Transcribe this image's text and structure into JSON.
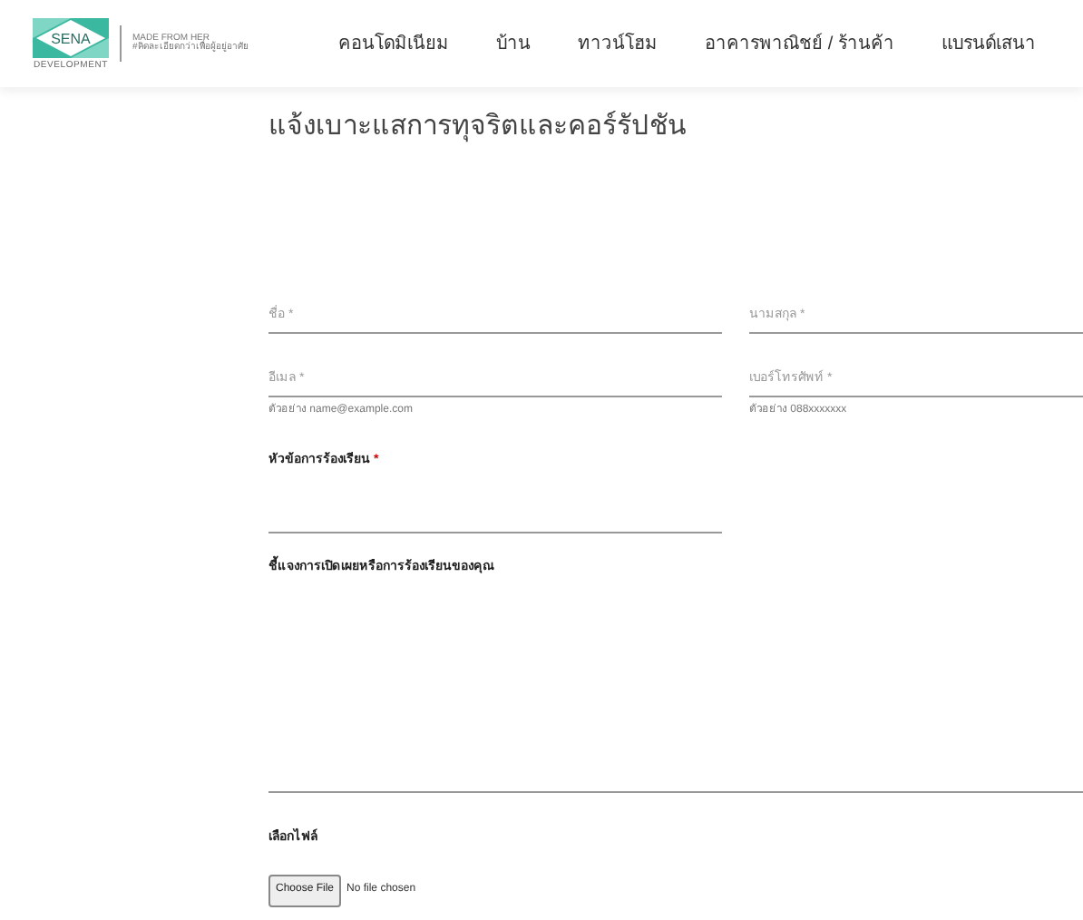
{
  "logo": {
    "brand": "SENA",
    "sub": "DEVELOPMENT",
    "tagline": "MADE FROM HER",
    "slogan": "#คิดละเอียดกว่าเพื่อผู้อยู่อาศัย"
  },
  "nav": [
    {
      "label": "คอนโดมิเนียม"
    },
    {
      "label": "บ้าน"
    },
    {
      "label": "ทาวน์โฮม"
    },
    {
      "label": "อาคารพาณิชย์ / ร้านค้า"
    },
    {
      "label": "แบรนด์เสนา"
    }
  ],
  "title": "แจ้งเบาะแสการทุจริตและคอร์รัปชัน",
  "fields": [
    {
      "placeholder": "ชื่อ *"
    },
    {
      "placeholder": "นามสกุล *"
    },
    {
      "placeholder": "อีเมล *",
      "hint": "ตัวอย่าง name@example.com"
    },
    {
      "placeholder": "เบอร์โทรศัพท์ *",
      "hint": "ตัวอย่าง 088xxxxxxx"
    }
  ],
  "subject": {
    "label": "หัวข้อการร้องเรียน",
    "required": "*"
  },
  "details": {
    "label": "ชี้แจงการเปิดเผยหรือการร้องเรียนของคุณ"
  },
  "file": {
    "label": "เลือกไฟล์",
    "button": "Choose File",
    "status": "No file chosen"
  }
}
